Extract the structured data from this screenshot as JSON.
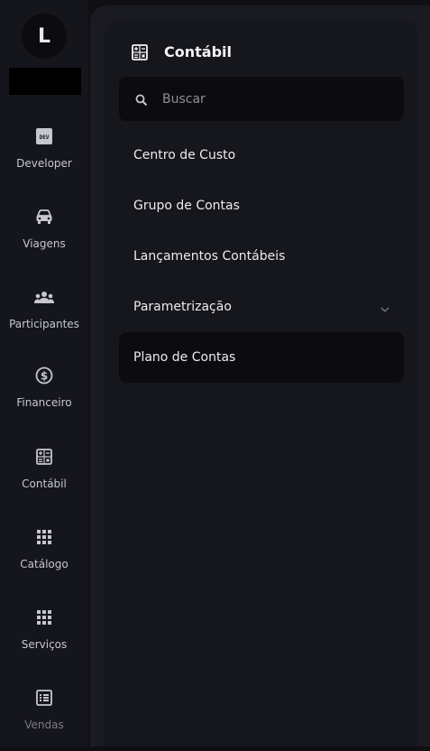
{
  "user": {
    "avatar_initial": "L"
  },
  "sidebar": {
    "items": [
      {
        "label": "Developer",
        "icon": "dev-icon"
      },
      {
        "label": "Viagens",
        "icon": "car-icon"
      },
      {
        "label": "Participantes",
        "icon": "group-icon"
      },
      {
        "label": "Financeiro",
        "icon": "dollar-icon"
      },
      {
        "label": "Contábil",
        "icon": "calculator-icon"
      },
      {
        "label": "Catálogo",
        "icon": "grid-icon"
      },
      {
        "label": "Serviços",
        "icon": "grid-icon"
      },
      {
        "label": "Vendas",
        "icon": "list-icon"
      }
    ]
  },
  "panel": {
    "title": "Contábil",
    "icon": "calculator-icon",
    "search_placeholder": "Buscar",
    "items": [
      {
        "label": "Centro de Custo"
      },
      {
        "label": "Grupo de Contas"
      },
      {
        "label": "Lançamentos Contábeis"
      },
      {
        "label": "Parametrização",
        "has_submenu": true
      },
      {
        "label": "Plano de Contas",
        "active": true
      }
    ]
  },
  "colors": {
    "rail_bg": "#15151c",
    "panel_bg": "#16161d",
    "active_bg": "#0c0c10",
    "text": "#ececf0"
  }
}
